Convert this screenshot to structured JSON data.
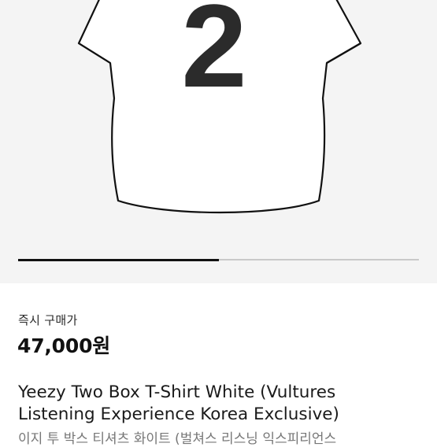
{
  "gallery": {
    "image_alt": "Yeezy Two Box T-Shirt White product image",
    "jersey_number": "2",
    "slide_progress": 0.5
  },
  "price": {
    "label": "즉시 구매가",
    "value": "47,000원"
  },
  "product": {
    "title_line1": "Yeezy Two Box T-Shirt White (Vultures",
    "title_line2": "Listening Experience Korea Exclusive)",
    "subtitle": "이지 투 박스 티셔츠 화이트 (벌쳐스 리스닝 익스피리언스"
  },
  "colors": {
    "gallery_bg": "#f4f4f4",
    "number_fill": "#2b2b2b",
    "progress_active": "#111111",
    "progress_track": "#c9c9c9"
  }
}
